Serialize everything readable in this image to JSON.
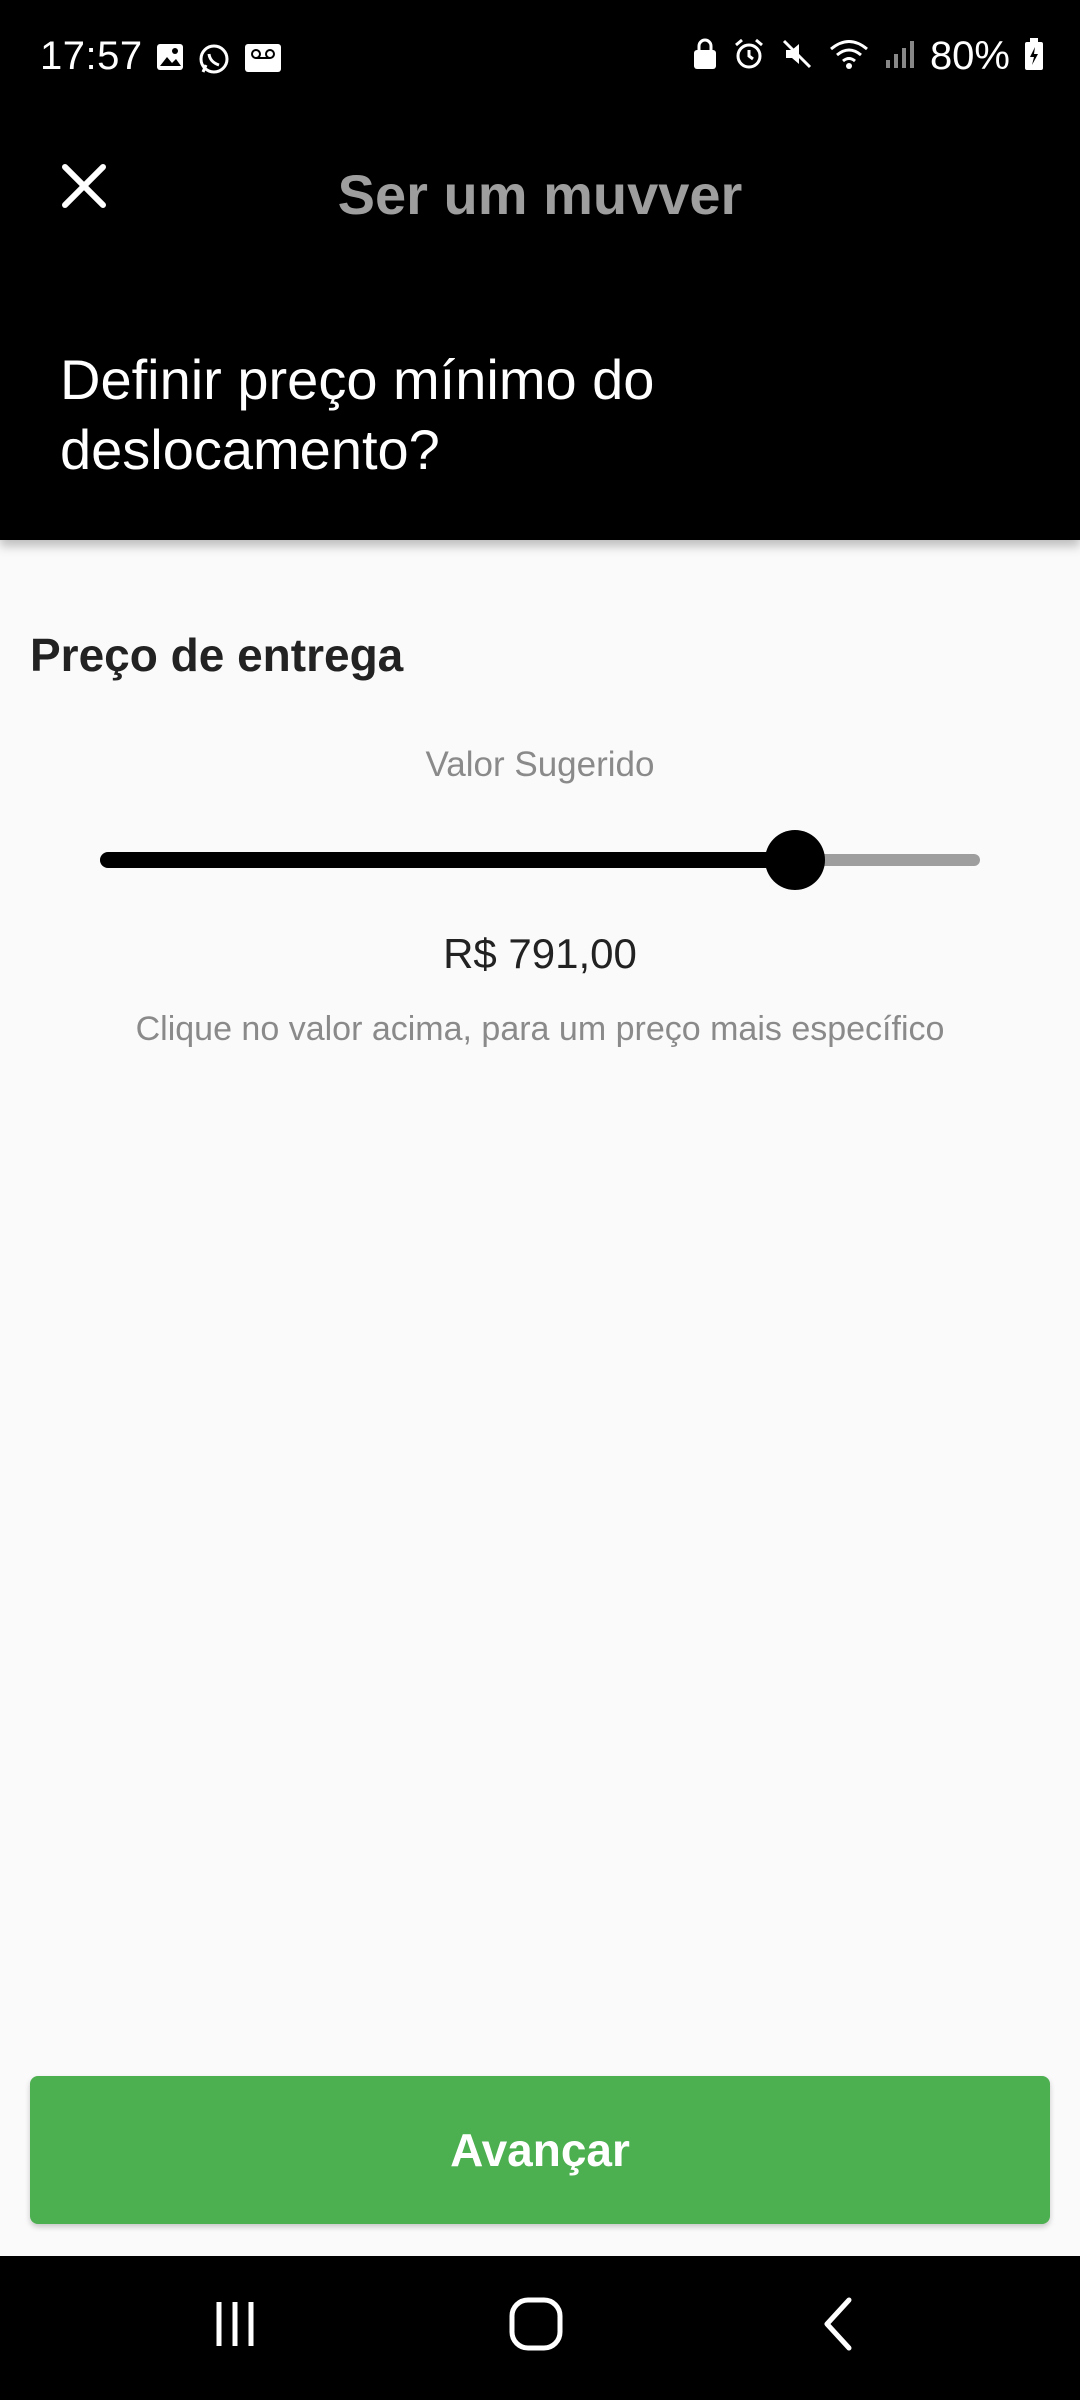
{
  "status_bar": {
    "time": "17:57",
    "battery": "80%",
    "left_icons": [
      "gallery-icon",
      "whatsapp-icon",
      "voicemail-icon"
    ],
    "right_icons": [
      "lock-icon",
      "alarm-icon",
      "mute-icon",
      "wifi-icon",
      "signal-icon",
      "battery-icon"
    ]
  },
  "header": {
    "close_icon": "close-icon",
    "title": "Ser um muvver",
    "question": "Definir preço mínimo do deslocamento?"
  },
  "content": {
    "section_title": "Preço de entrega",
    "suggested_label": "Valor Sugerido",
    "slider": {
      "level": 0.79
    },
    "price": "R$ 791,00",
    "hint": "Clique no valor acima, para um preço mais específico"
  },
  "actions": {
    "advance_label": "Avançar"
  },
  "nav_bar": {
    "icons": [
      "recent-apps-icon",
      "home-icon",
      "back-icon"
    ]
  },
  "colors": {
    "accent": "#4caf50",
    "header_bg": "#000000",
    "title_gray": "#9e9e9e",
    "page_bg": "#fafafa"
  }
}
